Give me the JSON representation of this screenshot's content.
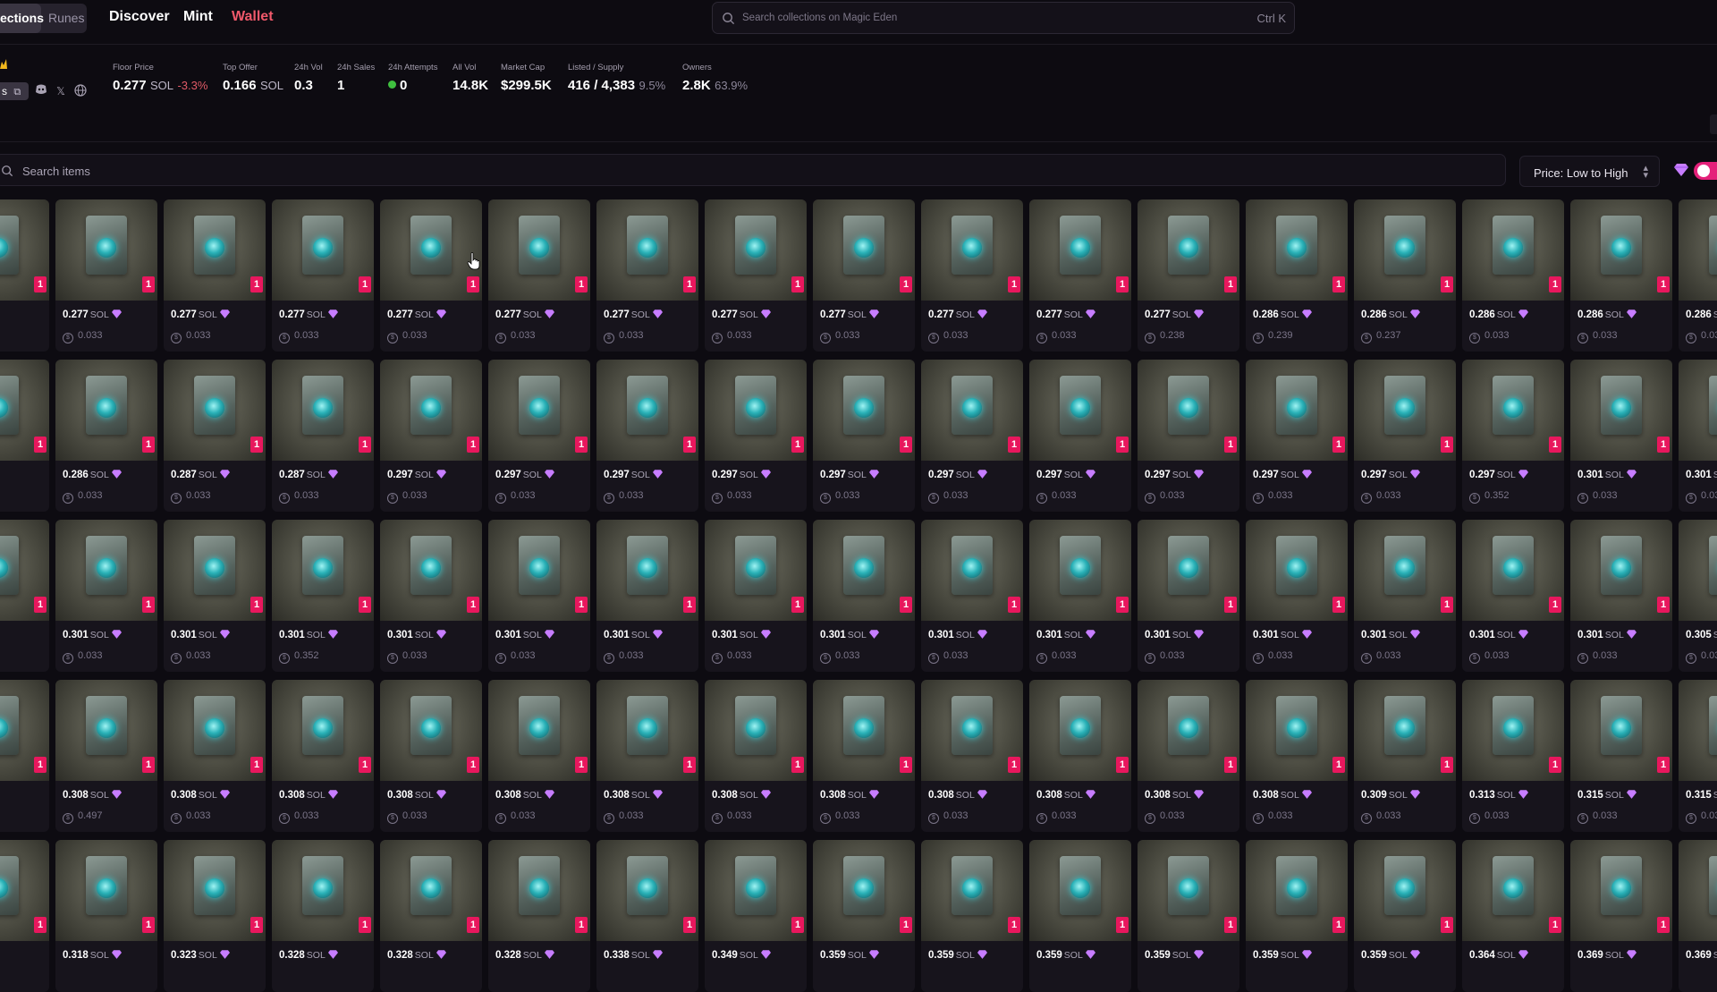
{
  "nav": {
    "seg_active": "ections",
    "seg_other": "Runes",
    "links": [
      "Discover",
      "Mint",
      "Wallet"
    ],
    "search_placeholder": "Search collections on Magic Eden",
    "search_shortcut": "Ctrl K"
  },
  "collection": {
    "short_label": "s",
    "stats": [
      {
        "label": "Floor Price",
        "value": "0.277",
        "unit": "SOL",
        "extra": "-3.3%",
        "extra_kind": "neg"
      },
      {
        "label": "Top Offer",
        "value": "0.166",
        "unit": "SOL"
      },
      {
        "label": "24h Vol",
        "value": "0.3"
      },
      {
        "label": "24h Sales",
        "value": "1"
      },
      {
        "label": "24h Attempts",
        "value": "0"
      },
      {
        "label": "All Vol",
        "value": "14.8K"
      },
      {
        "label": "Market Cap",
        "value": "$299.5K"
      },
      {
        "label": "Listed / Supply",
        "value": "416 / 4,383",
        "extra": "9.5%",
        "extra_kind": "muted"
      },
      {
        "label": "Owners",
        "value": "2.8K",
        "extra": "63.9%",
        "extra_kind": "muted"
      }
    ]
  },
  "filters": {
    "search_placeholder": "Search items",
    "sort_label": "Price: Low to High"
  },
  "colors": {
    "accent": "#e4217a",
    "badge": "#e8175d",
    "wallet": "#f0596b",
    "gem": "#c77dff"
  },
  "grid": {
    "unit": "SOL",
    "badge_text": "1",
    "rows": [
      [
        {
          "price": "",
          "last": ""
        },
        {
          "price": "0.277",
          "last": "0.033"
        },
        {
          "price": "0.277",
          "last": "0.033"
        },
        {
          "price": "0.277",
          "last": "0.033"
        },
        {
          "price": "0.277",
          "last": "0.033"
        },
        {
          "price": "0.277",
          "last": "0.033"
        },
        {
          "price": "0.277",
          "last": "0.033"
        },
        {
          "price": "0.277",
          "last": "0.033"
        },
        {
          "price": "0.277",
          "last": "0.033"
        },
        {
          "price": "0.277",
          "last": "0.033"
        },
        {
          "price": "0.277",
          "last": "0.033"
        },
        {
          "price": "0.277",
          "last": "0.238"
        },
        {
          "price": "0.286",
          "last": "0.239"
        },
        {
          "price": "0.286",
          "last": "0.237"
        },
        {
          "price": "0.286",
          "last": "0.033"
        },
        {
          "price": "0.286",
          "last": "0.033"
        },
        {
          "price": "0.286",
          "last": "0.03"
        }
      ],
      [
        {
          "price": "",
          "last": ""
        },
        {
          "price": "0.286",
          "last": "0.033"
        },
        {
          "price": "0.287",
          "last": "0.033"
        },
        {
          "price": "0.287",
          "last": "0.033"
        },
        {
          "price": "0.297",
          "last": "0.033"
        },
        {
          "price": "0.297",
          "last": "0.033"
        },
        {
          "price": "0.297",
          "last": "0.033"
        },
        {
          "price": "0.297",
          "last": "0.033"
        },
        {
          "price": "0.297",
          "last": "0.033"
        },
        {
          "price": "0.297",
          "last": "0.033"
        },
        {
          "price": "0.297",
          "last": "0.033"
        },
        {
          "price": "0.297",
          "last": "0.033"
        },
        {
          "price": "0.297",
          "last": "0.033"
        },
        {
          "price": "0.297",
          "last": "0.033"
        },
        {
          "price": "0.297",
          "last": "0.352"
        },
        {
          "price": "0.301",
          "last": "0.033"
        },
        {
          "price": "0.301",
          "last": "0.03"
        }
      ],
      [
        {
          "price": "",
          "last": ""
        },
        {
          "price": "0.301",
          "last": "0.033"
        },
        {
          "price": "0.301",
          "last": "0.033"
        },
        {
          "price": "0.301",
          "last": "0.352"
        },
        {
          "price": "0.301",
          "last": "0.033"
        },
        {
          "price": "0.301",
          "last": "0.033"
        },
        {
          "price": "0.301",
          "last": "0.033"
        },
        {
          "price": "0.301",
          "last": "0.033"
        },
        {
          "price": "0.301",
          "last": "0.033"
        },
        {
          "price": "0.301",
          "last": "0.033"
        },
        {
          "price": "0.301",
          "last": "0.033"
        },
        {
          "price": "0.301",
          "last": "0.033"
        },
        {
          "price": "0.301",
          "last": "0.033"
        },
        {
          "price": "0.301",
          "last": "0.033"
        },
        {
          "price": "0.301",
          "last": "0.033"
        },
        {
          "price": "0.301",
          "last": "0.033"
        },
        {
          "price": "0.305",
          "last": "0.03"
        }
      ],
      [
        {
          "price": "",
          "last": ""
        },
        {
          "price": "0.308",
          "last": "0.497"
        },
        {
          "price": "0.308",
          "last": "0.033"
        },
        {
          "price": "0.308",
          "last": "0.033"
        },
        {
          "price": "0.308",
          "last": "0.033"
        },
        {
          "price": "0.308",
          "last": "0.033"
        },
        {
          "price": "0.308",
          "last": "0.033"
        },
        {
          "price": "0.308",
          "last": "0.033"
        },
        {
          "price": "0.308",
          "last": "0.033"
        },
        {
          "price": "0.308",
          "last": "0.033"
        },
        {
          "price": "0.308",
          "last": "0.033"
        },
        {
          "price": "0.308",
          "last": "0.033"
        },
        {
          "price": "0.308",
          "last": "0.033"
        },
        {
          "price": "0.309",
          "last": "0.033"
        },
        {
          "price": "0.313",
          "last": "0.033"
        },
        {
          "price": "0.315",
          "last": "0.033"
        },
        {
          "price": "0.315",
          "last": "0.03"
        }
      ],
      [
        {
          "price": "",
          "last": ""
        },
        {
          "price": "0.318",
          "last": ""
        },
        {
          "price": "0.323",
          "last": ""
        },
        {
          "price": "0.328",
          "last": ""
        },
        {
          "price": "0.328",
          "last": ""
        },
        {
          "price": "0.328",
          "last": ""
        },
        {
          "price": "0.338",
          "last": ""
        },
        {
          "price": "0.349",
          "last": ""
        },
        {
          "price": "0.359",
          "last": ""
        },
        {
          "price": "0.359",
          "last": ""
        },
        {
          "price": "0.359",
          "last": ""
        },
        {
          "price": "0.359",
          "last": ""
        },
        {
          "price": "0.359",
          "last": ""
        },
        {
          "price": "0.359",
          "last": ""
        },
        {
          "price": "0.364",
          "last": ""
        },
        {
          "price": "0.369",
          "last": ""
        },
        {
          "price": "0.369",
          "last": ""
        }
      ]
    ]
  }
}
